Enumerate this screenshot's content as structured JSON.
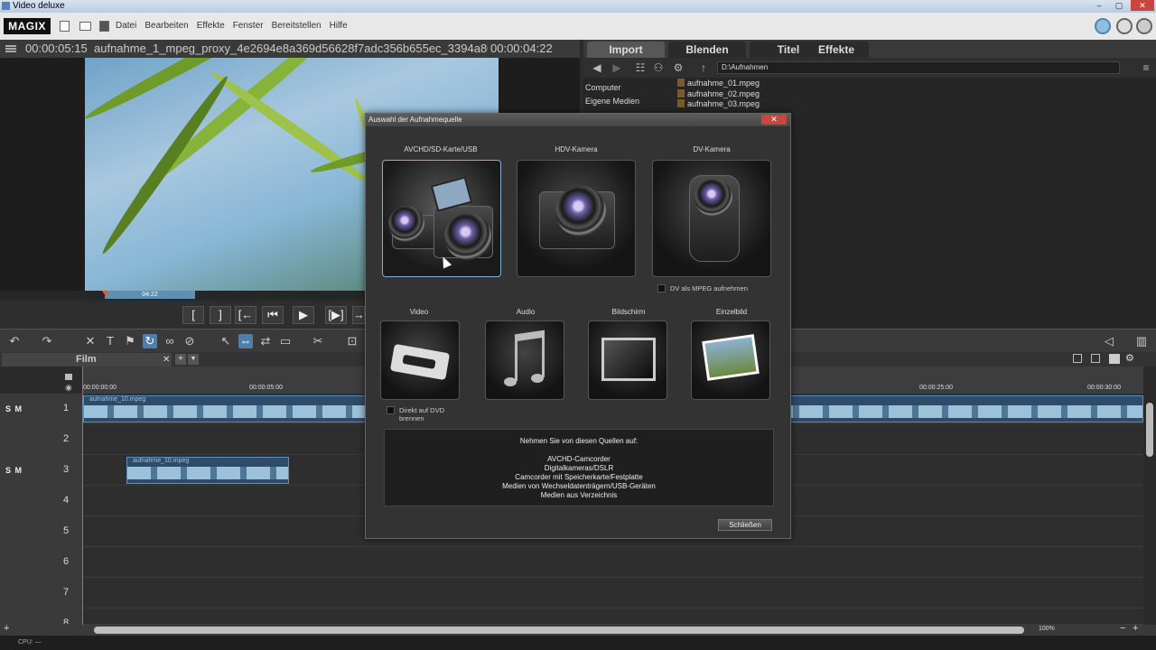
{
  "window": {
    "title": "Video deluxe",
    "btn_min": "–",
    "btn_max": "▢",
    "btn_close": "✕"
  },
  "menubar": {
    "logo": "MAGIX",
    "items": [
      "Datei",
      "Bearbeiten",
      "Effekte",
      "Fenster",
      "Bereitstellen",
      "Hilfe"
    ]
  },
  "preview": {
    "timecode_pos": "00:00:05:15",
    "filename": "aufnahme_1_mpeg_proxy_4e2694e8a369d56628f7adc356b655ec_3394a80fe73be61...",
    "timecode_len": "00:00:04:22",
    "marker": "04:22"
  },
  "transport": {
    "buttons": [
      "[",
      "]",
      "[←",
      "⏮",
      "▶",
      "[▶]",
      "→"
    ]
  },
  "mediapool": {
    "tabs": [
      "Import",
      "Blenden",
      "Titel",
      "Effekte"
    ],
    "active_tab": "Import",
    "path": "D:\\Aufnahmen",
    "locations": [
      "Computer",
      "Eigene Medien"
    ],
    "files": [
      "aufnahme_01.mpeg",
      "aufnahme_02.mpeg",
      "aufnahme_03.mpeg"
    ]
  },
  "timeline": {
    "tab": "Film",
    "ruler": [
      "00:00:00:00",
      "00:00:05:00",
      "00:00:25:00",
      "00:00:30:00"
    ],
    "track_controls": "S M",
    "tracks": [
      "1",
      "2",
      "3",
      "4",
      "5",
      "6",
      "7",
      "8"
    ],
    "clips": [
      {
        "name": "aufnahme_10.mpeg"
      },
      {
        "name": "aufnahme_10.mpeg"
      }
    ],
    "zoom": "100%"
  },
  "status": {
    "cpu": "CPU: —"
  },
  "dialog": {
    "title": "Auswahl der Aufnahmequelle",
    "close_x": "✕",
    "sources_large": [
      "AVCHD/SD-Karte/USB",
      "HDV-Kamera",
      "DV-Kamera"
    ],
    "sources_small": [
      "Video",
      "Audio",
      "Bildschirm",
      "Einzelbild"
    ],
    "dv_checkbox": "DV als MPEG aufnehmen",
    "dvd_checkbox": "Direkt auf DVD brennen",
    "info_head": "Nehmen Sie von diesen Quellen auf:",
    "info_lines": [
      "AVCHD-Camcorder",
      "Digitalkameras/DSLR",
      "Camcorder mit Speicherkarte/Festplatte",
      "Medien von Wechseldatenträgern/USB-Geräten",
      "Medien aus Verzeichnis"
    ],
    "close_button": "Schließen"
  }
}
